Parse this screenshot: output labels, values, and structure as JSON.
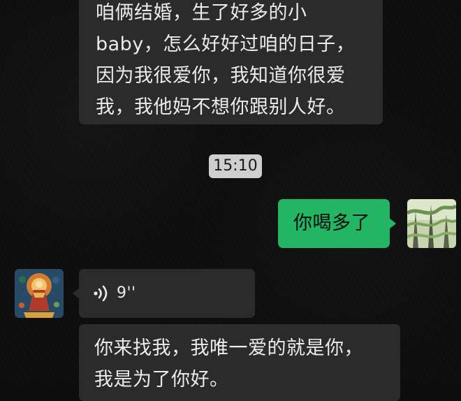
{
  "chat": {
    "messages": [
      {
        "direction": "in",
        "type": "text",
        "text": "咱俩结婚，生了好多的小\nbaby，怎么好好过咱的日子，\n因为我很爱你，我知道你很爱\n我，我他妈不想你跟别人好。"
      },
      {
        "type": "timestamp",
        "text": "15:10"
      },
      {
        "direction": "out",
        "type": "text",
        "text": "你喝多了"
      },
      {
        "direction": "in",
        "type": "voice",
        "duration": "9''"
      },
      {
        "direction": "in",
        "type": "text",
        "text": "你来找我，我唯一爱的就是你，\n我是为了你好。"
      }
    ]
  },
  "icons": {
    "voice": "voice-wave-icon"
  },
  "colors": {
    "background": "#0d0d0d",
    "incoming_bubble": "#2b2b2b",
    "outgoing_bubble": "#22b563",
    "timestamp_chip": "#cfcfcf"
  }
}
